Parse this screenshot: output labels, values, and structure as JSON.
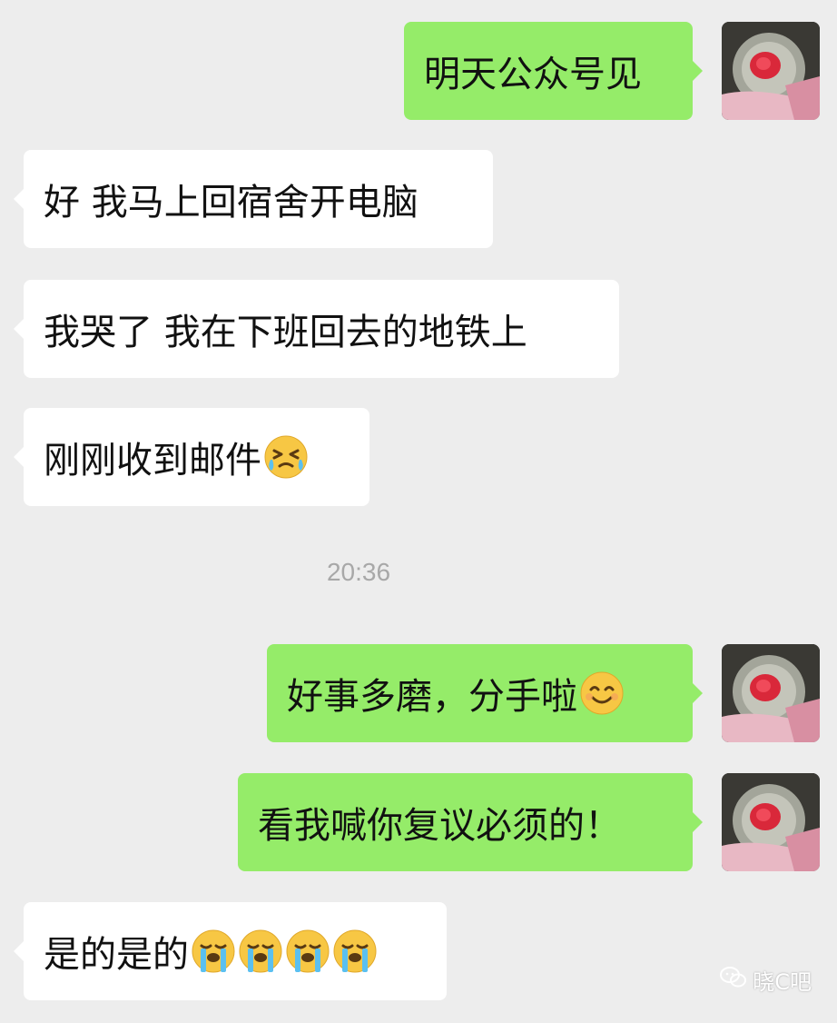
{
  "messages": [
    {
      "side": "out",
      "text": "明天公众号见"
    },
    {
      "side": "in",
      "text": "好 我马上回宿舍开电脑"
    },
    {
      "side": "in",
      "text": "我哭了 我在下班回去的地铁上"
    },
    {
      "side": "in",
      "text": "刚刚收到邮件",
      "emoji": "squinting-tears-emoji"
    },
    {
      "side": "out",
      "text": "好事多磨，分手啦",
      "emoji": "smiling-face-emoji"
    },
    {
      "side": "out",
      "text": "看我喊你复议必须的！"
    },
    {
      "side": "in",
      "text": "是的是的",
      "emoji": "loudly-crying-emoji",
      "emoji_count": 4
    }
  ],
  "timestamp": "20:36",
  "watermark": {
    "text": "晓C吧",
    "icon": "wechat-icon"
  },
  "colors": {
    "background": "#ededed",
    "incoming_bubble": "#ffffff",
    "outgoing_bubble": "#95ec69",
    "timestamp": "#a8a8a8"
  }
}
